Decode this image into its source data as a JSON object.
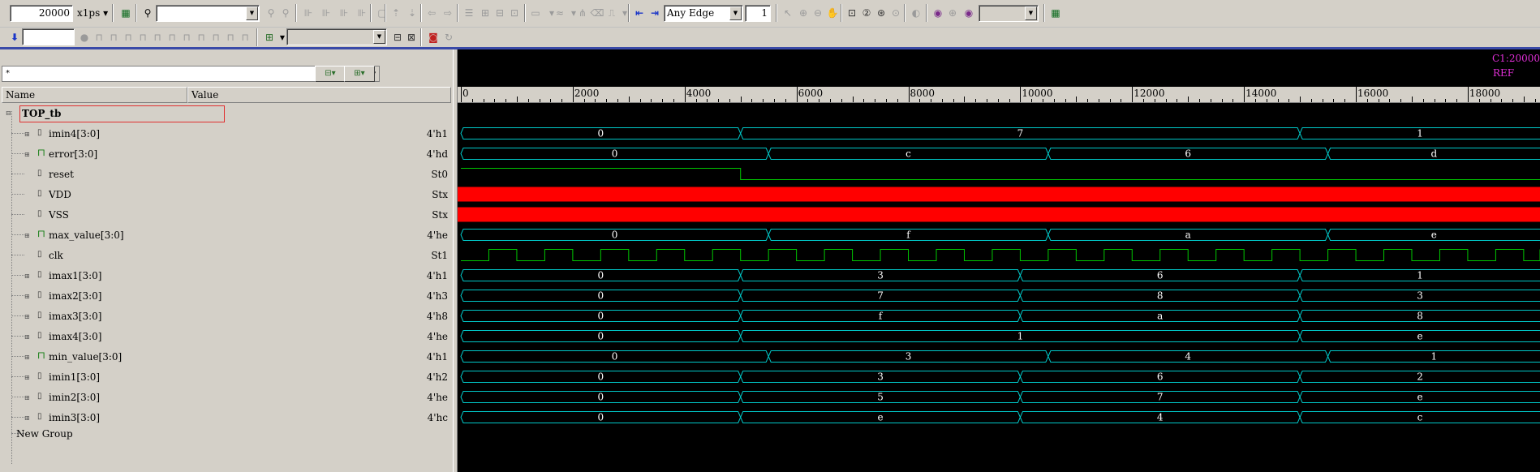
{
  "toolbar": {
    "time_value": "20000",
    "time_unit": "x1ps",
    "search_value": "",
    "edge_select": "Any Edge",
    "edge_count": "1",
    "scope_value": "",
    "group_select": ""
  },
  "signals_panel": {
    "filter": "*",
    "col_name": "Name",
    "col_value": "Value",
    "top": "TOP_tb",
    "new_group": "New Group"
  },
  "signals": [
    {
      "name": "imin4[3:0]",
      "value": "4'h1",
      "type": "bus-in",
      "segments": [
        {
          "v": "0",
          "t0": 0,
          "t1": 5000
        },
        {
          "v": "7",
          "t0": 5000,
          "t1": 15000
        },
        {
          "v": "1",
          "t0": 15000,
          "t1": 20000
        }
      ]
    },
    {
      "name": "error[3:0]",
      "value": "4'hd",
      "type": "bus-out",
      "segments": [
        {
          "v": "0",
          "t0": 0,
          "t1": 5500
        },
        {
          "v": "c",
          "t0": 5500,
          "t1": 10500
        },
        {
          "v": "6",
          "t0": 10500,
          "t1": 15500
        },
        {
          "v": "d",
          "t0": 15500,
          "t1": 20000
        }
      ]
    },
    {
      "name": "reset",
      "value": "St0",
      "type": "bit",
      "bit": [
        {
          "v": 1,
          "t0": 0,
          "t1": 5000
        },
        {
          "v": 0,
          "t0": 5000,
          "t1": 20000
        }
      ]
    },
    {
      "name": "VDD",
      "value": "Stx",
      "type": "x"
    },
    {
      "name": "VSS",
      "value": "Stx",
      "type": "x"
    },
    {
      "name": "max_value[3:0]",
      "value": "4'he",
      "type": "bus-out",
      "segments": [
        {
          "v": "0",
          "t0": 0,
          "t1": 5500
        },
        {
          "v": "f",
          "t0": 5500,
          "t1": 10500
        },
        {
          "v": "a",
          "t0": 10500,
          "t1": 15500
        },
        {
          "v": "e",
          "t0": 15500,
          "t1": 20000
        }
      ]
    },
    {
      "name": "clk",
      "value": "St1",
      "type": "clock",
      "clock_period": 1000
    },
    {
      "name": "imax1[3:0]",
      "value": "4'h1",
      "type": "bus-in",
      "segments": [
        {
          "v": "0",
          "t0": 0,
          "t1": 5000
        },
        {
          "v": "3",
          "t0": 5000,
          "t1": 10000
        },
        {
          "v": "6",
          "t0": 10000,
          "t1": 15000
        },
        {
          "v": "1",
          "t0": 15000,
          "t1": 20000
        }
      ]
    },
    {
      "name": "imax2[3:0]",
      "value": "4'h3",
      "type": "bus-in",
      "segments": [
        {
          "v": "0",
          "t0": 0,
          "t1": 5000
        },
        {
          "v": "7",
          "t0": 5000,
          "t1": 10000
        },
        {
          "v": "8",
          "t0": 10000,
          "t1": 15000
        },
        {
          "v": "3",
          "t0": 15000,
          "t1": 20000
        }
      ]
    },
    {
      "name": "imax3[3:0]",
      "value": "4'h8",
      "type": "bus-in",
      "segments": [
        {
          "v": "0",
          "t0": 0,
          "t1": 5000
        },
        {
          "v": "f",
          "t0": 5000,
          "t1": 10000
        },
        {
          "v": "a",
          "t0": 10000,
          "t1": 15000
        },
        {
          "v": "8",
          "t0": 15000,
          "t1": 20000
        }
      ]
    },
    {
      "name": "imax4[3:0]",
      "value": "4'he",
      "type": "bus-in",
      "segments": [
        {
          "v": "0",
          "t0": 0,
          "t1": 5000
        },
        {
          "v": "1",
          "t0": 5000,
          "t1": 15000
        },
        {
          "v": "e",
          "t0": 15000,
          "t1": 20000
        }
      ]
    },
    {
      "name": "min_value[3:0]",
      "value": "4'h1",
      "type": "bus-out",
      "segments": [
        {
          "v": "0",
          "t0": 0,
          "t1": 5500
        },
        {
          "v": "3",
          "t0": 5500,
          "t1": 10500
        },
        {
          "v": "4",
          "t0": 10500,
          "t1": 15500
        },
        {
          "v": "1",
          "t0": 15500,
          "t1": 20000
        }
      ]
    },
    {
      "name": "imin1[3:0]",
      "value": "4'h2",
      "type": "bus-in",
      "segments": [
        {
          "v": "0",
          "t0": 0,
          "t1": 5000
        },
        {
          "v": "3",
          "t0": 5000,
          "t1": 10000
        },
        {
          "v": "6",
          "t0": 10000,
          "t1": 15000
        },
        {
          "v": "2",
          "t0": 15000,
          "t1": 20000
        }
      ]
    },
    {
      "name": "imin2[3:0]",
      "value": "4'he",
      "type": "bus-in",
      "segments": [
        {
          "v": "0",
          "t0": 0,
          "t1": 5000
        },
        {
          "v": "5",
          "t0": 5000,
          "t1": 10000
        },
        {
          "v": "7",
          "t0": 10000,
          "t1": 15000
        },
        {
          "v": "e",
          "t0": 15000,
          "t1": 20000
        }
      ]
    },
    {
      "name": "imin3[3:0]",
      "value": "4'hc",
      "type": "bus-in",
      "segments": [
        {
          "v": "0",
          "t0": 0,
          "t1": 5000
        },
        {
          "v": "e",
          "t0": 5000,
          "t1": 10000
        },
        {
          "v": "4",
          "t0": 10000,
          "t1": 15000
        },
        {
          "v": "c",
          "t0": 15000,
          "t1": 20000
        }
      ]
    }
  ],
  "waveform": {
    "cursor_label": "C1:20000",
    "ref_label": "REF",
    "ruler_ticks": [
      "0",
      "2000",
      "4000",
      "6000",
      "8000",
      "10000",
      "12000",
      "14000",
      "16000",
      "18000"
    ],
    "ruler_tick_values": [
      0,
      2000,
      4000,
      6000,
      8000,
      10000,
      12000,
      14000,
      16000,
      18000
    ],
    "visible_range": [
      0,
      20000
    ],
    "colors": {
      "bus": "#00c8c8",
      "clock": "#00c800",
      "x": "#ff0000",
      "text": "#ffffff",
      "cursor": "#e22fd8"
    }
  }
}
